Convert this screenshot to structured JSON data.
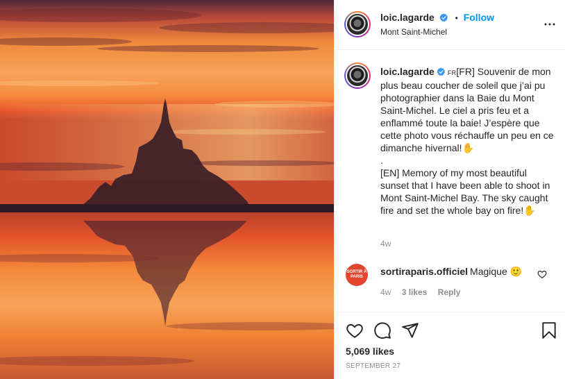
{
  "post": {
    "author": {
      "username": "loic.lagarde",
      "verified": true,
      "location": "Mont Saint-Michel"
    },
    "follow_label": "Follow",
    "separator": "•",
    "caption": {
      "lang_tag": "FR",
      "paragraph_fr": "[FR] Souvenir de mon plus beau coucher de soleil que j’ai pu photographier dans la Baie du Mont Saint-Michel. Le ciel a pris feu et a enflammé toute la baie! J’espère que cette photo vous réchauffe un peu en ce dimanche hivernal!✋",
      "separator_dot": ".",
      "paragraph_en": "[EN] Memory of my most beautiful sunset that I have been able to shoot in Mont Saint-Michel Bay. The sky caught fire and set the whole bay on fire!✋",
      "time_ago": "4w"
    },
    "comments": [
      {
        "username": "sortiraparis.officiel",
        "avatar_text": "SORTIR À PARIS",
        "text": "Magique 🙂",
        "time_ago": "4w",
        "likes": "3 likes",
        "reply_label": "Reply"
      }
    ],
    "likes": "5,069 likes",
    "date": "SEPTEMBER 27"
  },
  "icons": {
    "more": "more-horizontal-icon",
    "like": "heart-icon",
    "comment": "comment-bubble-icon",
    "share": "paper-plane-icon",
    "save": "bookmark-icon",
    "verified": "verified-badge-icon"
  },
  "colors": {
    "accent": "#0095f6",
    "verified": "#3897f0",
    "text": "#262626",
    "muted": "#8e8e8e",
    "border": "#efefef"
  }
}
